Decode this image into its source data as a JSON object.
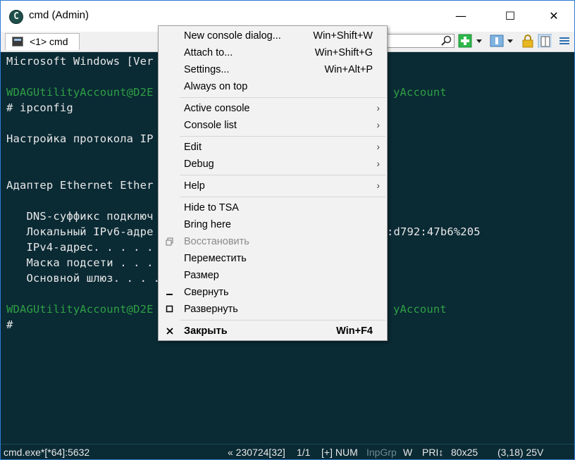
{
  "window": {
    "title": "cmd (Admin)",
    "app_icon": "conemu-icon",
    "controls": {
      "minimize": "—",
      "maximize": "☐",
      "close": "✕"
    }
  },
  "tab": {
    "label": "<1> cmd",
    "icon": "console-icon"
  },
  "terminal": {
    "colors": {
      "background": "#0a2a34",
      "text": "#e8e8e8",
      "prompt_green": "#2ea043"
    },
    "lines": [
      {
        "text": "Microsoft Windows [Ver",
        "color": "white"
      },
      {
        "text": "WDAGUtilityAccount@D2E",
        "color": "green"
      },
      {
        "text": "yAccount",
        "color": "green"
      },
      {
        "text": "# ipconfig",
        "color": "white"
      },
      {
        "text": "Настройка протокола IP",
        "color": "white"
      },
      {
        "text": "Адаптер Ethernet Ether",
        "color": "white"
      },
      {
        "text": "   DNS-суффикс подключ",
        "color": "white"
      },
      {
        "text": "   Локальный IPv6-адре",
        "color": "white"
      },
      {
        "text": ":d792:47b6%205",
        "color": "white"
      },
      {
        "text": "   IPv4-адрес. . . . .",
        "color": "white"
      },
      {
        "text": "   Маска подсети . . .",
        "color": "white"
      },
      {
        "text": "   Основной шлюз. . . .",
        "color": "white"
      },
      {
        "text": "WDAGUtilityAccount@D2E",
        "color": "green"
      },
      {
        "text": "yAccount",
        "color": "green"
      },
      {
        "text": "#",
        "color": "white"
      }
    ]
  },
  "context_menu": {
    "items": [
      {
        "label": "New console dialog...",
        "shortcut": "Win+Shift+W"
      },
      {
        "label": "Attach to...",
        "shortcut": "Win+Shift+G"
      },
      {
        "label": "Settings...",
        "shortcut": "Win+Alt+P"
      },
      {
        "label": "Always on top",
        "shortcut": ""
      },
      {
        "label": "Active console",
        "submenu": true
      },
      {
        "label": "Console list",
        "submenu": true
      },
      {
        "label": "Edit",
        "submenu": true
      },
      {
        "label": "Debug",
        "submenu": true
      },
      {
        "label": "Help",
        "submenu": true
      },
      {
        "label": "Hide to TSA"
      },
      {
        "label": "Bring here"
      },
      {
        "label": "Восстановить",
        "disabled": true,
        "icon": "restore-icon"
      },
      {
        "label": "Переместить"
      },
      {
        "label": "Размер"
      },
      {
        "label": "Свернуть",
        "icon": "minimize-icon"
      },
      {
        "label": "Развернуть",
        "icon": "maximize-icon"
      },
      {
        "label": "Закрыть",
        "shortcut": "Win+F4",
        "bold": true,
        "icon": "close-icon"
      }
    ],
    "submenu_arrow": "›"
  },
  "status_bar": {
    "process": "cmd.exe*[*64]:5632",
    "build": "« 230724[32]",
    "pages": "1/1",
    "flags": "[+] NUM",
    "inpgrp": "InpGrp",
    "w": "W",
    "pri": "PRI↕",
    "size": "80x25",
    "cursor": "(3,18) 25V"
  }
}
